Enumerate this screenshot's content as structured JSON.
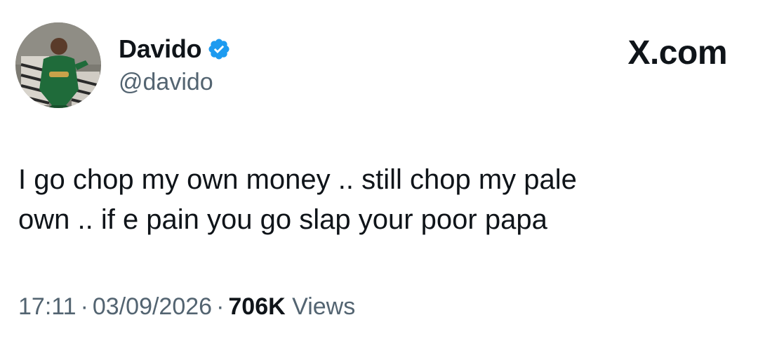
{
  "author": {
    "display_name": "Davido",
    "handle": "@davido",
    "verified": true,
    "avatar_icon": "person-in-green-suit-avatar"
  },
  "brand": {
    "label": "X.com"
  },
  "tweet": {
    "lines": [
      "I go chop my own money .. still chop my pale",
      "own .. if e pain you go slap your poor papa"
    ]
  },
  "meta": {
    "time": "17:11",
    "separator": "·",
    "date": "03/09/2026",
    "views_count": "706K",
    "views_label": "Views"
  },
  "colors": {
    "text": "#0f1419",
    "secondary": "#536471",
    "verified_blue": "#1d9bf0"
  }
}
